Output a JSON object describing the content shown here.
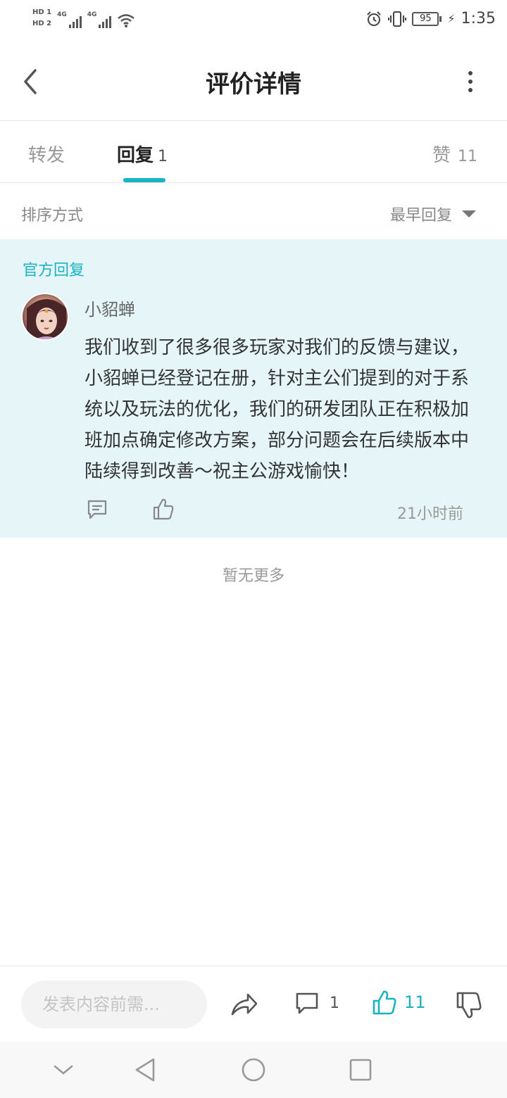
{
  "status_bar": {
    "hd_top": "HD 1",
    "hd_bottom": "HD 2",
    "net1": "4G",
    "net2": "4G",
    "battery": "95",
    "time": "1:35"
  },
  "nav": {
    "title": "评价详情"
  },
  "tabs": {
    "repost_label": "转发",
    "reply_label": "回复",
    "reply_count": "1",
    "likes_label": "赞",
    "likes_count": "11"
  },
  "sort": {
    "label": "排序方式",
    "selected": "最早回复"
  },
  "official_reply": {
    "label": "官方回复",
    "author": "小貂蝉",
    "content": "我们收到了很多很多玩家对我们的反馈与建议，小貂蝉已经登记在册，针对主公们提到的对于系统以及玩法的优化，我们的研发团队正在积极加班加点确定修改方案，部分问题会在后续版本中陆续得到改善～祝主公游戏愉快！",
    "time": "21小时前"
  },
  "list_end": "暂无更多",
  "bottom_bar": {
    "input_placeholder": "发表内容前需...",
    "comment_count": "1",
    "like_count": "11"
  },
  "colors": {
    "accent": "#19b4c0",
    "official_bg": "#e5f5f8"
  },
  "icons": [
    "back-icon",
    "more-icon",
    "dropdown-icon",
    "comment-icon",
    "like-icon",
    "share-icon",
    "dislike-icon",
    "nav-back-icon",
    "home-icon",
    "recents-icon",
    "collapse-icon"
  ]
}
